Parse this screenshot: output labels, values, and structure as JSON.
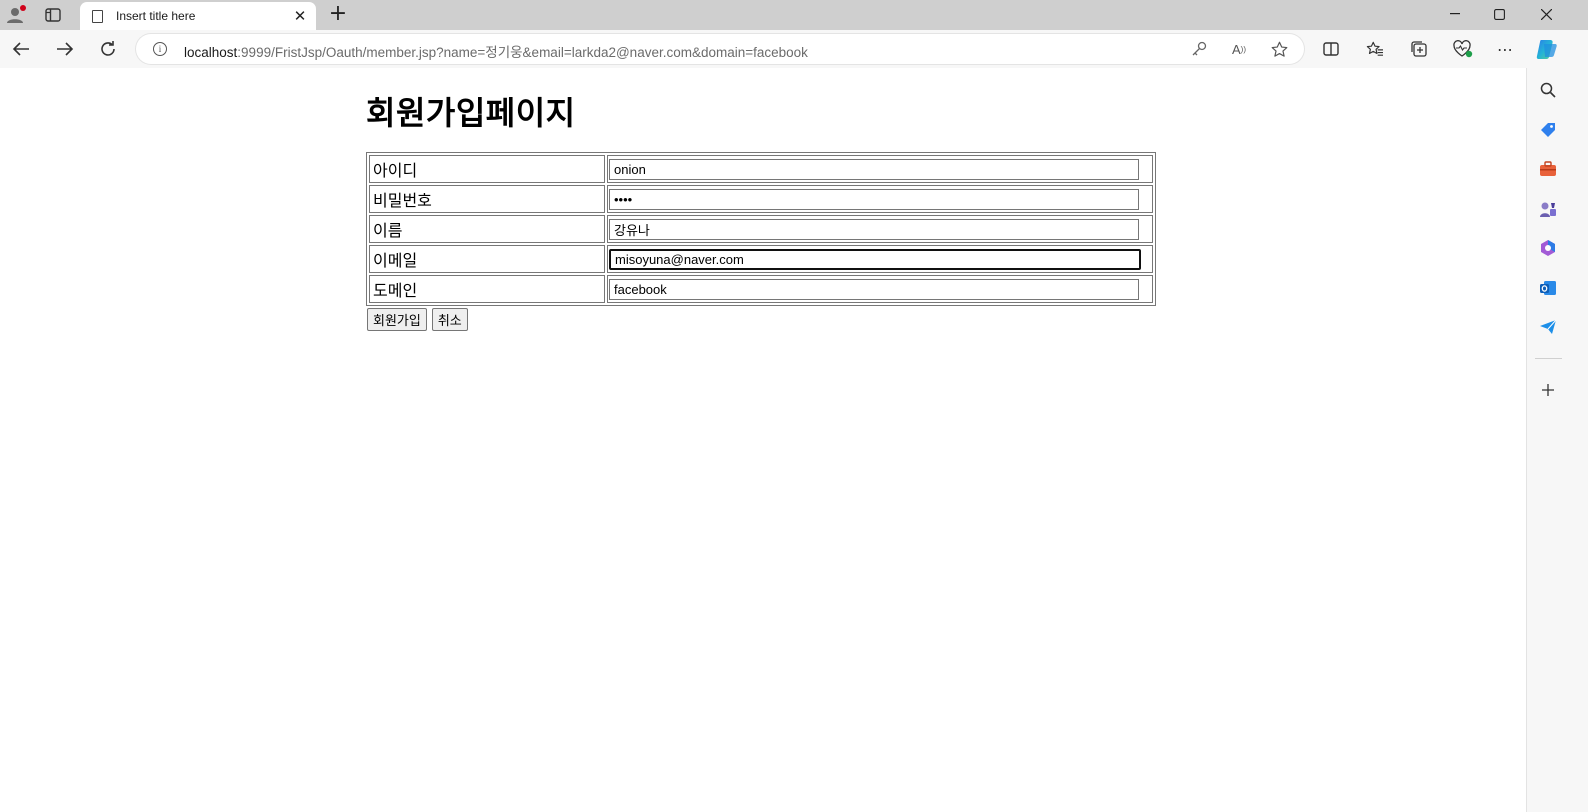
{
  "browser": {
    "tab_title": "Insert title here",
    "new_tab_glyph": "+",
    "url_host": "localhost",
    "url_rest": ":9999/FristJsp/Oauth/member.jsp?name=정기웅&email=larkda2@naver.com&domain=facebook",
    "window_controls": [
      "minimize",
      "maximize",
      "close"
    ]
  },
  "page": {
    "title": "회원가입페이지",
    "fields": [
      {
        "label": "아이디",
        "value": "onion",
        "type": "text"
      },
      {
        "label": "비밀번호",
        "value": "••••",
        "type": "password"
      },
      {
        "label": "이름",
        "value": "강유나",
        "type": "text"
      },
      {
        "label": "이메일",
        "value": "misoyuna@naver.com",
        "type": "text"
      },
      {
        "label": "도메인",
        "value": "facebook",
        "type": "text"
      }
    ],
    "submit_label": "회원가입",
    "cancel_label": "취소"
  },
  "sidebar_icons": [
    "search-icon",
    "tag-icon",
    "toolbox-icon",
    "games-icon",
    "office-icon",
    "outlook-icon",
    "send-icon",
    "add-icon"
  ],
  "colors": {
    "tabstrip": "#cfcfcf",
    "toolbar": "#f7f7f7",
    "accent_blue": "#1a73e8"
  }
}
